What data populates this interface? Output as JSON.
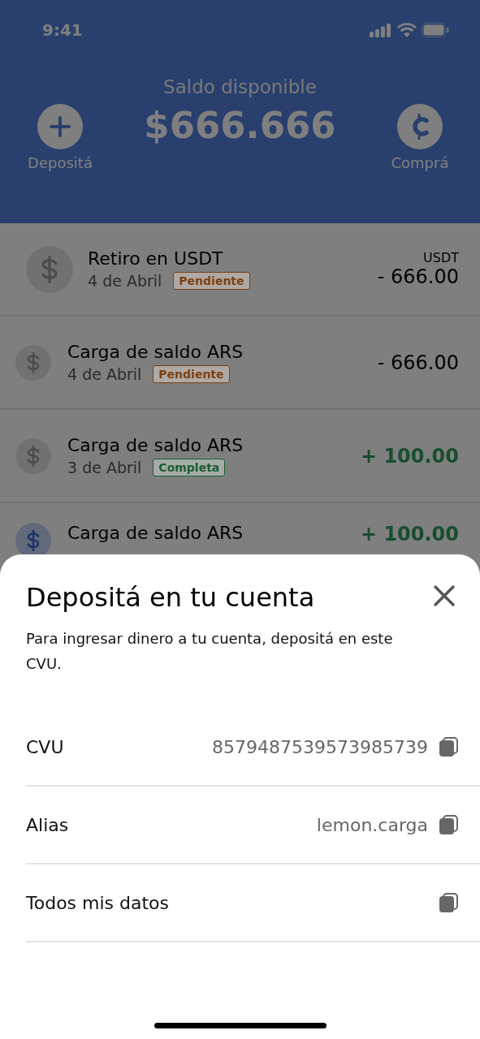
{
  "status_bar": {
    "time": "9:41"
  },
  "header": {
    "title": "Saldo disponible",
    "balance": "$666.666",
    "actions": [
      {
        "kind": "deposit",
        "label": "Depositá"
      },
      {
        "kind": "buy",
        "label": "Comprá"
      }
    ]
  },
  "transactions": [
    {
      "title": "Retiro en USDT",
      "date": "4 de Abril",
      "status": "Pendiente",
      "color": "#7e4010",
      "currency": "USDT",
      "amount": "- 666.00",
      "credit": false,
      "featured": true
    },
    {
      "title": "Carga de saldo ARS",
      "date": "4 de Abril",
      "status": "Pendiente",
      "color": "#7e4010",
      "amount": "- 666.00",
      "credit": false,
      "featured": false
    },
    {
      "title": "Carga de saldo ARS",
      "date": "3 de Abril",
      "status": "Completa",
      "color": "#1a5e33",
      "amount": "+ 100.00",
      "credit": true,
      "featured": false
    },
    {
      "title": "Carga de saldo ARS",
      "amount": "+ 100.00",
      "credit": true,
      "featured": false
    }
  ],
  "sheet": {
    "title": "Depositá en tu cuenta",
    "description": "Para ingresar dinero a tu cuenta, depositá en este CVU.",
    "rows": [
      {
        "label": "CVU",
        "value": "8579487539573985739"
      },
      {
        "label": "Alias",
        "value": "lemon.carga"
      },
      {
        "label": "Todos mis datos"
      }
    ]
  }
}
